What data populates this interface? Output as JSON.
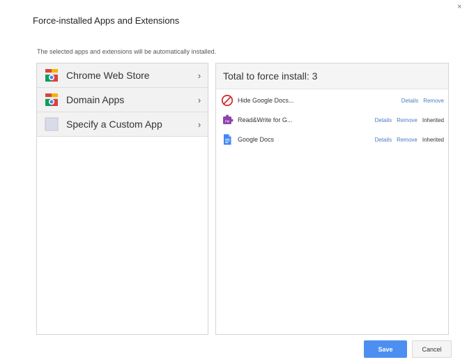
{
  "dialog": {
    "title": "Force-installed Apps and Extensions",
    "subtitle": "The selected apps and extensions will be automatically installed.",
    "close_label": "×"
  },
  "left_panel": {
    "items": [
      {
        "label": "Chrome Web Store",
        "icon": "chrome-web-store-icon",
        "chevron": "›"
      },
      {
        "label": "Domain Apps",
        "icon": "domain-apps-icon",
        "chevron": "›"
      },
      {
        "label": "Specify a Custom App",
        "icon": "custom-app-icon",
        "chevron": "›"
      }
    ]
  },
  "right_panel": {
    "header": "Total to force install: 3",
    "apps": [
      {
        "name": "Hide Google Docs...",
        "icon": "blocked-icon",
        "details": "Details",
        "remove": "Remove",
        "inherited": ""
      },
      {
        "name": "Read&Write for G...",
        "icon": "read-write-extension-icon",
        "details": "Details",
        "remove": "Remove",
        "inherited": "Inherited"
      },
      {
        "name": "Google Docs",
        "icon": "google-docs-icon",
        "details": "Details",
        "remove": "Remove",
        "inherited": "Inherited"
      }
    ]
  },
  "footer": {
    "save_label": "Save",
    "cancel_label": "Cancel"
  },
  "colors": {
    "primary_button": "#4d8ff0",
    "link": "#4a7cc7",
    "blocked": "#d32f2f",
    "docs_blue": "#4285f4",
    "extension_purple": "#8e44ad"
  }
}
